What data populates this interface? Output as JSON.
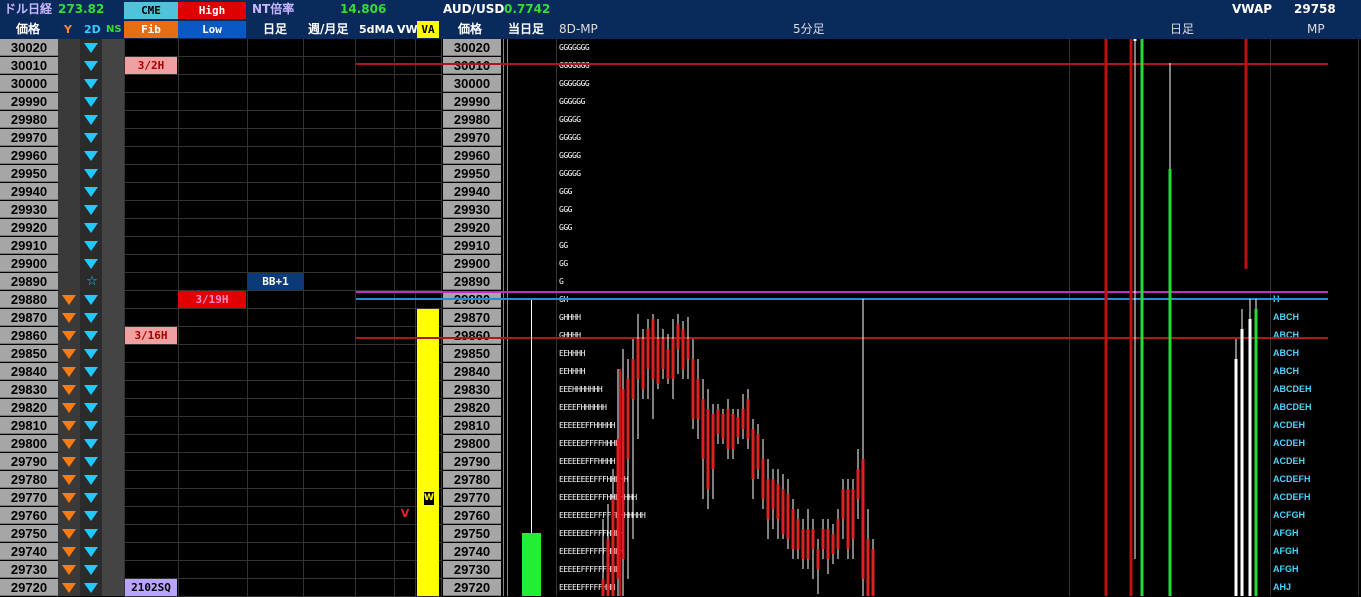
{
  "header": {
    "nikkei_dollar_label": "ドル日経",
    "nikkei_dollar_value": "273.82",
    "cme_label": "CME",
    "high_label": "High",
    "nt_ratio_label": "NT倍率",
    "nt_ratio_value": "14.806",
    "audusd_label": "AUD/USD",
    "audusd_value": "0.7742",
    "vwap_label": "VWAP",
    "vwap_value": "29758",
    "price_label": "価格",
    "y_label": "Y",
    "d2_label": "2D",
    "ns_label": "NS",
    "fib_label": "Fib",
    "low_label": "Low",
    "daily_label": "日足",
    "weekly_monthly_label": "週/月足",
    "ma5_label": "5dMA",
    "vw_label": "VW",
    "va_label": "VA",
    "price_label2": "価格",
    "today_label": "当日足",
    "mp8d_label": "8D-MP",
    "min5_label": "5分足",
    "daily_label2": "日足",
    "mp_label": "MP"
  },
  "prices": [
    "30020",
    "30010",
    "30000",
    "29990",
    "29980",
    "29970",
    "29960",
    "29950",
    "29940",
    "29930",
    "29920",
    "29910",
    "29900",
    "29890",
    "29880",
    "29870",
    "29860",
    "29850",
    "29840",
    "29830",
    "29820",
    "29810",
    "29800",
    "29790",
    "29780",
    "29770",
    "29760",
    "29750",
    "29740",
    "29730",
    "29720"
  ],
  "y_marks": [
    "",
    "",
    "",
    "",
    "",
    "",
    "",
    "",
    "",
    "",
    "",
    "",
    "",
    "",
    "down",
    "down",
    "down",
    "down",
    "down",
    "down",
    "down",
    "down",
    "down",
    "down",
    "down",
    "down",
    "down",
    "down",
    "down",
    "down",
    "down"
  ],
  "d2_marks": [
    "down",
    "down",
    "down",
    "down",
    "down",
    "down",
    "down",
    "down",
    "down",
    "down",
    "down",
    "down",
    "down",
    "star",
    "down",
    "down",
    "down",
    "down",
    "down",
    "down",
    "down",
    "down",
    "down",
    "down",
    "down",
    "down",
    "down",
    "down",
    "down",
    "down",
    "down"
  ],
  "labels": {
    "cme_3_2h": "3/2H",
    "high_3_19h": "3/19H",
    "cme_3_16h": "3/16H",
    "cme_2102sq": "2102SQ",
    "bb_plus1": "BB+1",
    "vw_v": "V",
    "va_w": "W"
  },
  "tpo_8d": [
    "GGGGGGG",
    "GGGGGGG",
    "GGGGGGG",
    "GGGGGG",
    "GGGGG",
    "GGGGG",
    "GGGGG",
    "GGGGG",
    "GGG",
    "GGG",
    "GGG",
    "GG",
    "GG",
    "G",
    "GH",
    "GHHHH",
    "GHHHH",
    "EEHHHH",
    "EEHHHH",
    "EEEHHHHHHH",
    "EEEEFHHHHHH",
    "EEEEEEFFHHHHH",
    "EEEEEEFFFFHHHH",
    "EEEEEEFFFHHHH",
    "EEEEEEEEFFFHHHHH",
    "EEEEEEEEFFFHHHHHHH",
    "EEEEEEEEFFFFFHHHHHHH",
    "EEEEEEEFFFFHHHH",
    "EEEEEEFFFFFHHHH",
    "EEEEEFFFFFFHHH",
    "EEEEEFFFFFHHH"
  ],
  "mp_letters": [
    "",
    "",
    "",
    "",
    "",
    "",
    "",
    "",
    "",
    "",
    "",
    "",
    "",
    "",
    "H",
    "ABCH",
    "ABCH",
    "ABCH",
    "ABCH",
    "ABCDEH",
    "ABCDEH",
    "ACDEH",
    "ACDEH",
    "ACDEH",
    "ACDEFH",
    "ACDEFH",
    "ACFGH",
    "AFGH",
    "AFGH",
    "AFGH",
    "AHJ"
  ],
  "colors": {
    "header_bg": "#0a2a5c",
    "cme_bg": "#4fc3d9",
    "high_bg": "#e00000",
    "fib_bg": "#e56e12",
    "low_bg": "#0a58c4",
    "va_bg": "#ffff00",
    "price_bg": "#a6a6a6",
    "tri_orange": "#ff7a10",
    "tri_cyan": "#22c8ff"
  }
}
